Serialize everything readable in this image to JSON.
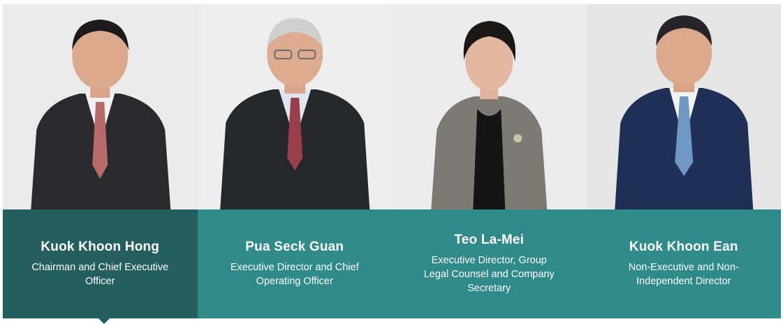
{
  "directors": [
    {
      "name": "Kuok Khoon Hong",
      "role": "Chairman and Chief Executive Officer",
      "photo_icon": "portrait-photo",
      "active": true
    },
    {
      "name": "Pua Seck Guan",
      "role": "Executive Director and Chief Operating Officer",
      "photo_icon": "portrait-photo",
      "active": false
    },
    {
      "name": "Teo La-Mei",
      "role": "Executive Director, Group Legal Counsel and Company Secretary",
      "photo_icon": "portrait-photo",
      "active": false
    },
    {
      "name": "Kuok Khoon Ean",
      "role": "Non-Executive and Non-Independent Director",
      "photo_icon": "portrait-photo",
      "active": false
    }
  ],
  "colors": {
    "card_bg": "#2f8a8a",
    "active_bg": "#245f5f",
    "photo_bg": "#ececec",
    "text": "#ffffff"
  }
}
